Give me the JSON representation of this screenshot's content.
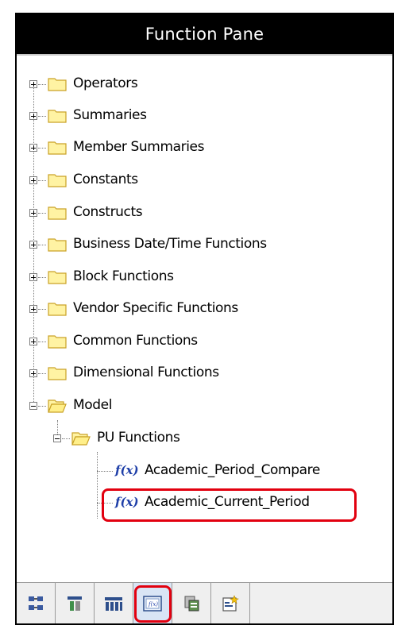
{
  "pane": {
    "title": "Function Pane"
  },
  "tree": {
    "folders": [
      {
        "label": "Operators",
        "state": "collapsed"
      },
      {
        "label": "Summaries",
        "state": "collapsed"
      },
      {
        "label": "Member Summaries",
        "state": "collapsed"
      },
      {
        "label": "Constants",
        "state": "collapsed"
      },
      {
        "label": "Constructs",
        "state": "collapsed"
      },
      {
        "label": "Business Date/Time Functions",
        "state": "collapsed"
      },
      {
        "label": "Block Functions",
        "state": "collapsed"
      },
      {
        "label": "Vendor Specific Functions",
        "state": "collapsed"
      },
      {
        "label": "Common Functions",
        "state": "collapsed"
      },
      {
        "label": "Dimensional Functions",
        "state": "collapsed"
      },
      {
        "label": "Model",
        "state": "expanded"
      }
    ],
    "subfolder": {
      "label": "PU Functions",
      "state": "expanded"
    },
    "functions": [
      {
        "label": "Academic_Period_Compare",
        "icon": "f(x)"
      },
      {
        "label": "Academic_Current_Period",
        "icon": "f(x)",
        "highlighted": true
      }
    ]
  },
  "toolbar": {
    "buttons": [
      {
        "icon": "tree-structure-icon"
      },
      {
        "icon": "table-hierarchy-icon"
      },
      {
        "icon": "columns-icon"
      },
      {
        "icon": "function-icon",
        "selected": true
      },
      {
        "icon": "query-items-icon"
      },
      {
        "icon": "new-item-icon"
      }
    ]
  },
  "colors": {
    "title_bg": "#000000",
    "title_fg": "#ffffff",
    "highlight": "#e2000f",
    "folder_fill": "#fff3a3",
    "folder_border": "#c9a227",
    "fx_color": "#1f3fa8"
  }
}
